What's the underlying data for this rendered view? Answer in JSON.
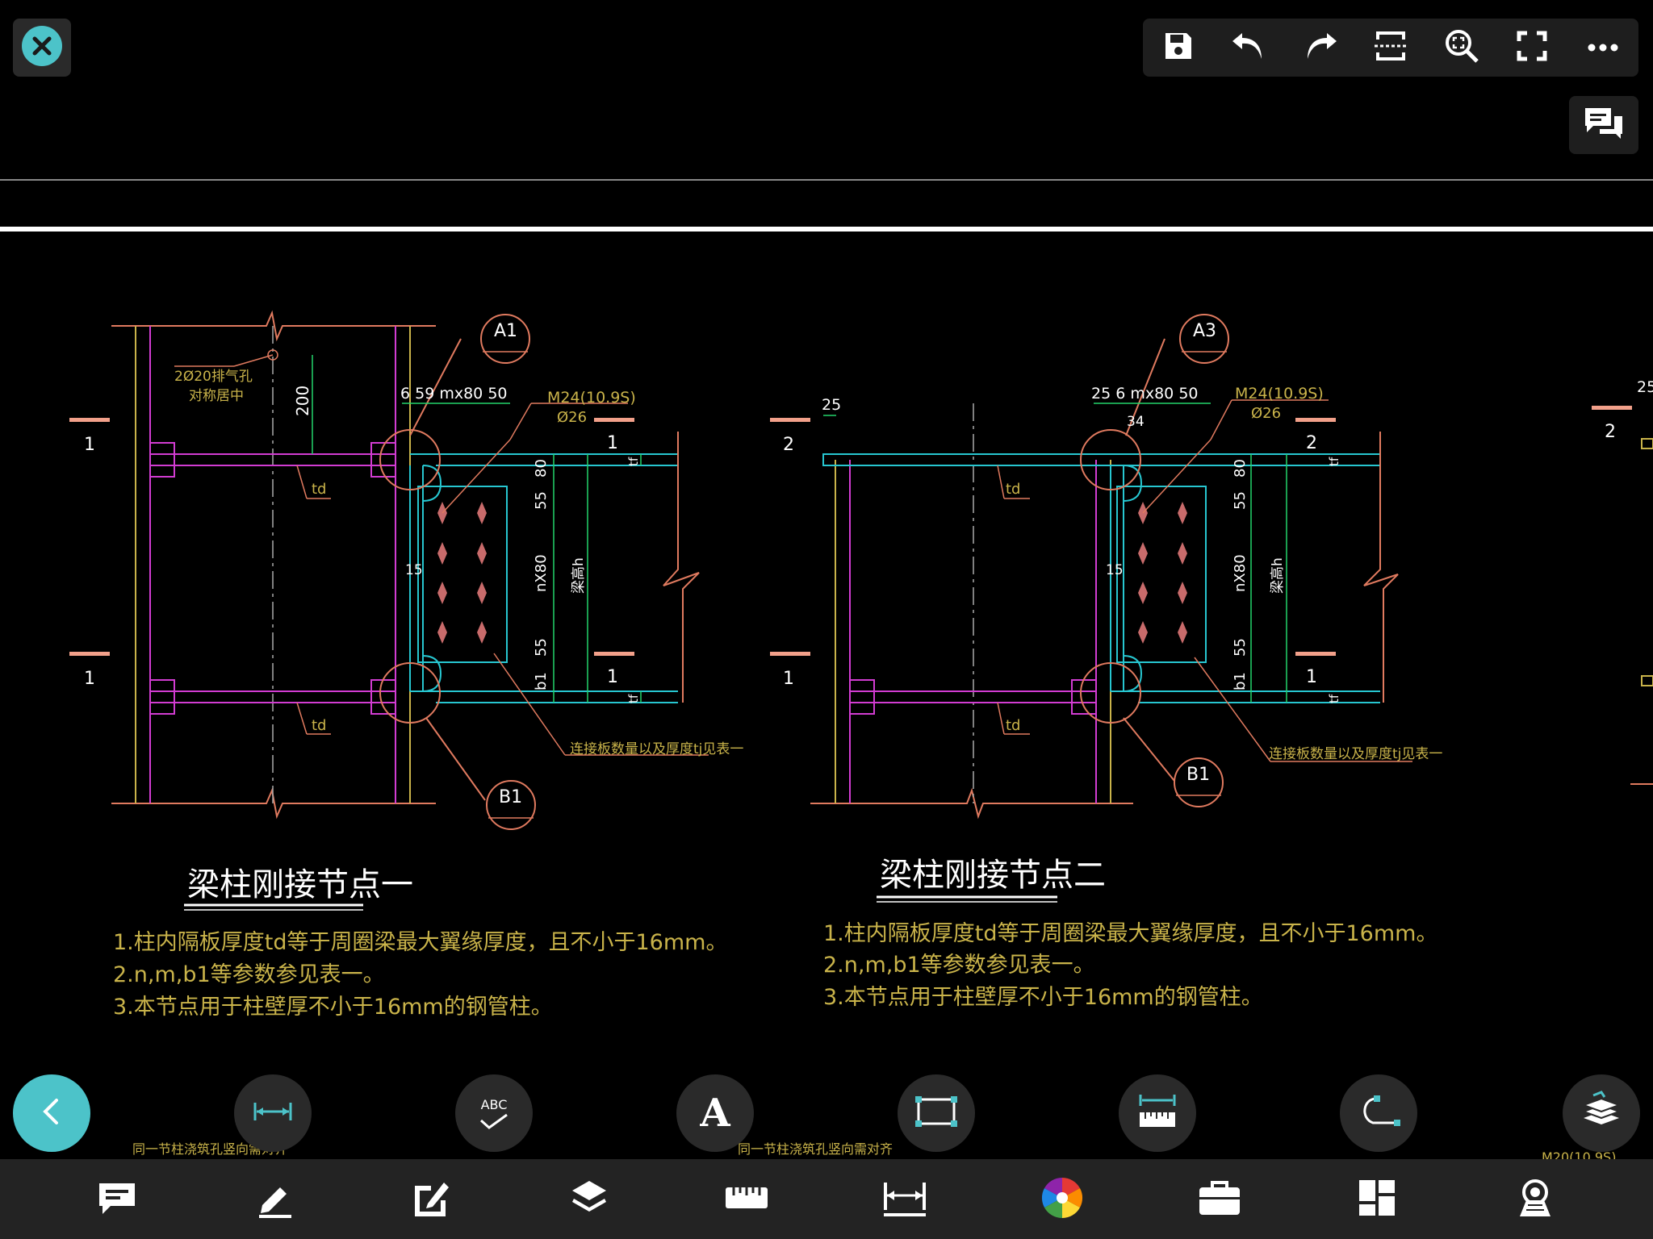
{
  "app": {
    "close_icon": "close-icon",
    "top_toolbar": [
      {
        "name": "save",
        "icon": "save-icon"
      },
      {
        "name": "undo",
        "icon": "undo-icon"
      },
      {
        "name": "redo",
        "icon": "redo-icon"
      },
      {
        "name": "window-select",
        "icon": "window-select-icon"
      },
      {
        "name": "zoom",
        "icon": "zoom-icon"
      },
      {
        "name": "fullscreen",
        "icon": "fullscreen-icon"
      },
      {
        "name": "more",
        "icon": "more-icon"
      }
    ],
    "comments_icon": "comments-icon",
    "float_tools": [
      {
        "name": "back",
        "icon": "back-icon"
      },
      {
        "name": "dimension",
        "icon": "dimension-icon"
      },
      {
        "name": "spell-check",
        "icon": "spell-check-icon",
        "label": "ABC"
      },
      {
        "name": "text",
        "icon": "text-icon",
        "label": "A"
      },
      {
        "name": "rectangle",
        "icon": "rectangle-icon"
      },
      {
        "name": "measure",
        "icon": "measure-icon"
      },
      {
        "name": "polyline",
        "icon": "polyline-icon"
      },
      {
        "name": "layers",
        "icon": "layers-icon"
      }
    ],
    "bottom_toolbar": [
      {
        "name": "annotation",
        "icon": "annotation-icon"
      },
      {
        "name": "draw",
        "icon": "pencil-icon"
      },
      {
        "name": "edit",
        "icon": "edit-icon"
      },
      {
        "name": "layers",
        "icon": "layers-icon"
      },
      {
        "name": "measure",
        "icon": "ruler-icon"
      },
      {
        "name": "dimension",
        "icon": "dimension-icon"
      },
      {
        "name": "color",
        "icon": "color-wheel-icon"
      },
      {
        "name": "toolbox",
        "icon": "toolbox-icon"
      },
      {
        "name": "grid",
        "icon": "grid-icon"
      },
      {
        "name": "view",
        "icon": "view-icon"
      }
    ],
    "colors": {
      "accent": "#4cc3c9",
      "magenta": "#d23cd2",
      "cyan": "#27c6d0",
      "yellow": "#c9b34a",
      "green": "#22d46a",
      "orange": "#e07a5f",
      "white": "#ffffff"
    }
  },
  "drawing": {
    "detail1": {
      "title": "梁柱刚接节点一",
      "notes": [
        "1.柱内隔板厚度td等于周圈梁最大翼缘厚度，且不小于16mm。",
        "2.n,m,b1等参数参见表一。",
        "3.本节点用于柱壁厚不小于16mm的钢管柱。"
      ],
      "vent_label_1": "2Ø20排气孔",
      "vent_label_2": "对称居中",
      "dim_200": "200",
      "dim_top": "6  59  mx80  50",
      "bolt_label": "M24(10.9S)",
      "hole_label": "Ø26",
      "callout_a": "A1",
      "callout_b": "B1",
      "plate_note": "连接板数量以及厚度tj见表一",
      "dim_80": "80",
      "dim_55a": "55",
      "dim_nx80": "nX80",
      "dim_55b": "55",
      "dim_b1": "b1",
      "beam_height": "梁高h",
      "dim_15": "15",
      "td_top": "td",
      "td_bottom": "td",
      "tf_top": "tf",
      "tf_bottom": "tf",
      "sec_1_left_top": "1",
      "sec_1_left_bottom": "1",
      "sec_1_right_top": "1",
      "sec_1_right_bottom": "1"
    },
    "detail2": {
      "title": "梁柱刚接节点二",
      "notes": [
        "1.柱内隔板厚度td等于周圈梁最大翼缘厚度，且不小于16mm。",
        "2.n,m,b1等参数参见表一。",
        "3.本节点用于柱壁厚不小于16mm的钢管柱。"
      ],
      "dim_25_left": "25",
      "dim_top": "25  6  mx80  50",
      "dim_34": "34",
      "bolt_label": "M24(10.9S)",
      "hole_label": "Ø26",
      "callout_a": "A3",
      "callout_b": "B1",
      "plate_note": "连接板数量以及厚度tj见表一",
      "dim_80": "80",
      "dim_55a": "55",
      "dim_nx80": "nX80",
      "dim_55b": "55",
      "dim_b1": "b1",
      "beam_height": "梁高h",
      "dim_15": "15",
      "td_top": "td",
      "td_bottom": "td",
      "tf_top": "tf",
      "tf_bottom": "tf",
      "sec_2_left": "2",
      "sec_2_right": "2",
      "sec_1_left": "1",
      "sec_1_right": "1"
    },
    "partial_right": {
      "dim": "25",
      "sec": "2"
    },
    "footer_text_left": "同一节柱浇筑孔竖向需对齐",
    "footer_text_mid": "同一节柱浇筑孔竖向需对齐",
    "footer_text_right": "M20(10.9S)"
  }
}
